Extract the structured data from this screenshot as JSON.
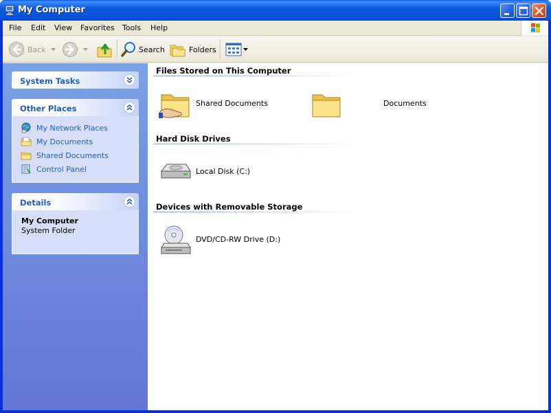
{
  "window": {
    "title": "My Computer"
  },
  "menu": {
    "items": [
      "File",
      "Edit",
      "View",
      "Favorites",
      "Tools",
      "Help"
    ]
  },
  "toolbar": {
    "back_label": "Back",
    "search_label": "Search",
    "folders_label": "Folders"
  },
  "taskpane": {
    "system_tasks_title": "System Tasks",
    "other_places_title": "Other Places",
    "other_places": [
      {
        "label": "My Network Places",
        "icon": "network-places-icon"
      },
      {
        "label": "My Documents",
        "icon": "my-documents-icon"
      },
      {
        "label": "Shared Documents",
        "icon": "folder-icon"
      },
      {
        "label": "Control Panel",
        "icon": "control-panel-icon"
      }
    ],
    "details_title": "Details",
    "details_name": "My Computer",
    "details_type": "System Folder"
  },
  "content": {
    "groups": [
      {
        "title": "Files Stored on This Computer",
        "items": [
          {
            "label": "Shared Documents",
            "icon": "shared-folder-icon"
          },
          {
            "label": "Documents",
            "icon": "folder-icon"
          }
        ]
      },
      {
        "title": "Hard Disk Drives",
        "items": [
          {
            "label": "Local Disk (C:)",
            "icon": "hard-disk-icon"
          }
        ]
      },
      {
        "title": "Devices with Removable Storage",
        "items": [
          {
            "label": "DVD/CD-RW Drive (D:)",
            "icon": "cd-drive-icon"
          }
        ]
      }
    ]
  },
  "colors": {
    "titlebar": "#0552d7",
    "taskpane_top": "#7aa1e6",
    "taskpane_bottom": "#6375d6",
    "link": "#215dc6"
  }
}
